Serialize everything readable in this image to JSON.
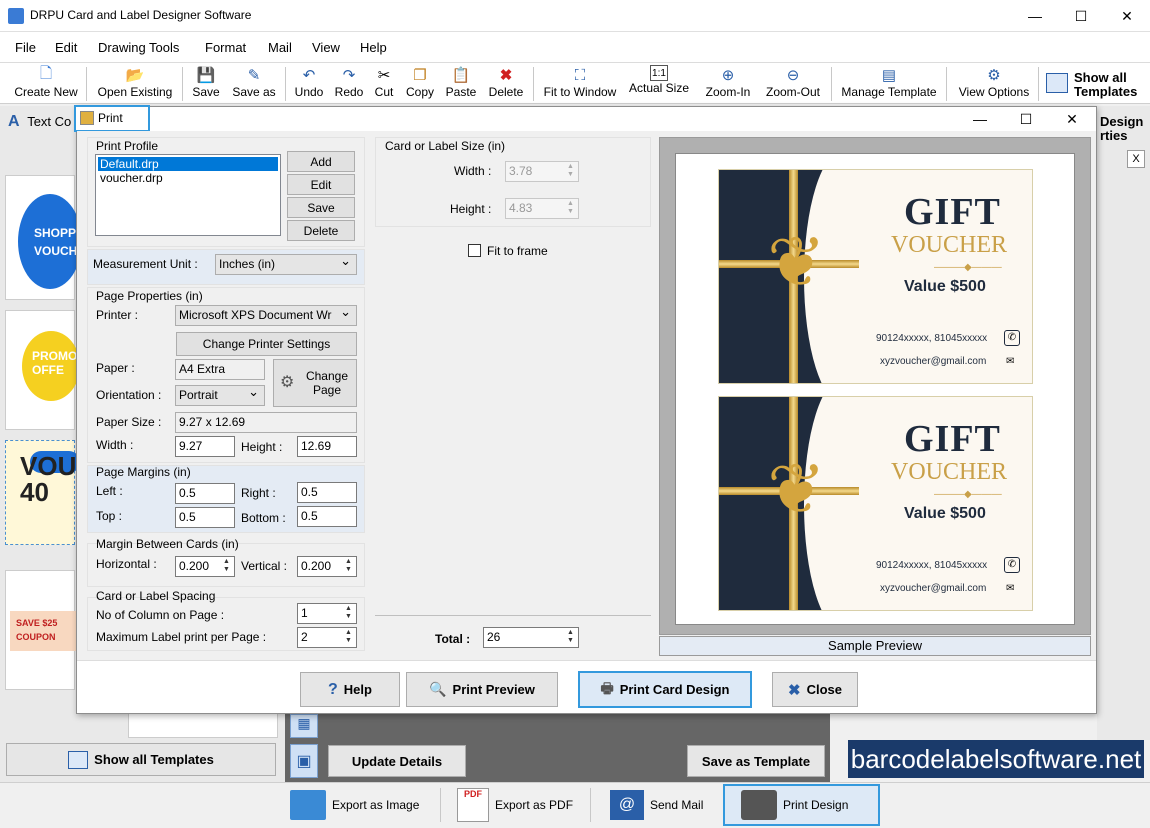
{
  "app": {
    "title": "DRPU Card and Label Designer Software",
    "window_controls": {
      "minimize": "—",
      "maximize": "☐",
      "close": "✕"
    }
  },
  "menu": [
    "File",
    "Edit",
    "Drawing Tools",
    "Format",
    "Mail",
    "View",
    "Help"
  ],
  "toolbar": {
    "items": [
      {
        "label": "Create New",
        "icon": "new-file-icon"
      },
      {
        "label": "Open Existing",
        "icon": "folder-icon"
      },
      {
        "label": "Save",
        "icon": "save-icon"
      },
      {
        "label": "Save as",
        "icon": "save-as-icon"
      },
      {
        "label": "Undo",
        "icon": "undo-icon"
      },
      {
        "label": "Redo",
        "icon": "redo-icon"
      },
      {
        "label": "Cut",
        "icon": "cut-icon"
      },
      {
        "label": "Copy",
        "icon": "copy-icon"
      },
      {
        "label": "Paste",
        "icon": "paste-icon"
      },
      {
        "label": "Delete",
        "icon": "delete-icon"
      },
      {
        "label": "Fit to Window",
        "icon": "fit-window-icon"
      },
      {
        "label": "Actual Size",
        "icon": "actual-size-icon"
      },
      {
        "label": "Zoom-In",
        "icon": "zoom-in-icon"
      },
      {
        "label": "Zoom-Out",
        "icon": "zoom-out-icon"
      },
      {
        "label": "Manage Template",
        "icon": "manage-template-icon"
      },
      {
        "label": "View Options",
        "icon": "gear-icon"
      }
    ],
    "show_all_templates": "Show all Templates"
  },
  "background": {
    "text_tab": "Text Co",
    "design_properties": "Design",
    "design_properties_2": "rties",
    "close_x": "X",
    "thumbs": [
      "SHOPP VOUCHE",
      "PROMO OFFE",
      "VOUC 40",
      "SAVE $25 COUPON"
    ],
    "show_all_templates_btn": "Show all Templates",
    "update_details_btn": "Update Details",
    "save_as_template_btn": "Save as Template",
    "watermark": "barcodelabelsoftware.net",
    "bottom_bar": [
      "Export as Image",
      "Export as PDF",
      "Send Mail",
      "Print Design"
    ]
  },
  "dialog": {
    "title": "Print",
    "print_profile": {
      "label": "Print Profile",
      "items": [
        "Default.drp",
        "voucher.drp"
      ],
      "buttons": [
        "Add",
        "Edit",
        "Save",
        "Delete"
      ]
    },
    "measurement": {
      "label": "Measurement Unit :",
      "value": "Inches (in)"
    },
    "page_properties": {
      "label": "Page Properties (in)",
      "printer_label": "Printer :",
      "printer_value": "Microsoft XPS Document Wr",
      "change_printer_btn": "Change Printer Settings",
      "paper_label": "Paper :",
      "paper_value": "A4 Extra",
      "orientation_label": "Orientation :",
      "orientation_value": "Portrait",
      "change_page_btn": "Change Page",
      "paper_size_label": "Paper Size :",
      "paper_size_value": "9.27 x 12.69",
      "width_label": "Width :",
      "width_value": "9.27",
      "height_label": "Height :",
      "height_value": "12.69"
    },
    "margins": {
      "label": "Page Margins (in)",
      "left_label": "Left :",
      "left_value": "0.5",
      "right_label": "Right :",
      "right_value": "0.5",
      "top_label": "Top :",
      "top_value": "0.5",
      "bottom_label": "Bottom :",
      "bottom_value": "0.5"
    },
    "between": {
      "label": "Margin Between Cards (in)",
      "horizontal_label": "Horizontal :",
      "horizontal_value": "0.200",
      "vertical_label": "Vertical :",
      "vertical_value": "0.200"
    },
    "spacing": {
      "label": "Card or Label Spacing",
      "columns_label": "No of Column on Page :",
      "columns_value": "1",
      "max_label": "Maximum Label print per Page :",
      "max_value": "2"
    },
    "card_size": {
      "label": "Card or Label Size (in)",
      "width_label": "Width :",
      "width_value": "3.78",
      "height_label": "Height :",
      "height_value": "4.83"
    },
    "fit_to_frame": "Fit to frame",
    "total_label": "Total :",
    "total_value": "26",
    "preview_label": "Sample Preview",
    "card": {
      "gift": "GIFT",
      "voucher": "VOUCHER",
      "value": "Value $500",
      "phone": "90124xxxxx, 81045xxxxx",
      "email": "xyzvoucher@gmail.com"
    },
    "buttons": {
      "help": "Help",
      "print_preview": "Print Preview",
      "print_card": "Print Card Design",
      "close": "Close"
    }
  }
}
